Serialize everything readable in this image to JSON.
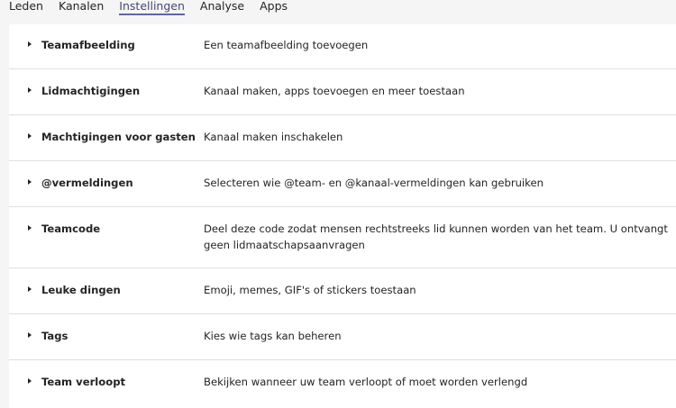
{
  "tabs": [
    {
      "label": "Leden"
    },
    {
      "label": "Kanalen"
    },
    {
      "label": "Instellingen",
      "active": true
    },
    {
      "label": "Analyse"
    },
    {
      "label": "Apps"
    }
  ],
  "settings": [
    {
      "title": "Teamafbeelding",
      "description": "Een teamafbeelding toevoegen"
    },
    {
      "title": "Lidmachtigingen",
      "description": "Kanaal maken, apps toevoegen en meer toestaan"
    },
    {
      "title": "Machtigingen voor gasten",
      "description": "Kanaal maken inschakelen"
    },
    {
      "title": "@vermeldingen",
      "description": "Selecteren wie @team- en @kanaal-vermeldingen kan gebruiken"
    },
    {
      "title": "Teamcode",
      "description": "Deel deze code zodat mensen rechtstreeks lid kunnen worden van het team. U ontvangt geen lidmaatschapsaanvragen"
    },
    {
      "title": "Leuke dingen",
      "description": "Emoji, memes, GIF's of stickers toestaan"
    },
    {
      "title": "Tags",
      "description": "Kies wie tags kan beheren"
    },
    {
      "title": "Team verloopt",
      "description": "Bekijken wanneer uw team verloopt of moet worden verlengd"
    }
  ],
  "colors": {
    "accent": "#6264a7",
    "page_background": "#f5f5f5",
    "panel_background": "#ffffff",
    "divider": "#e1dfdd"
  },
  "icons": {
    "row_expander": "chevron-right-icon"
  }
}
